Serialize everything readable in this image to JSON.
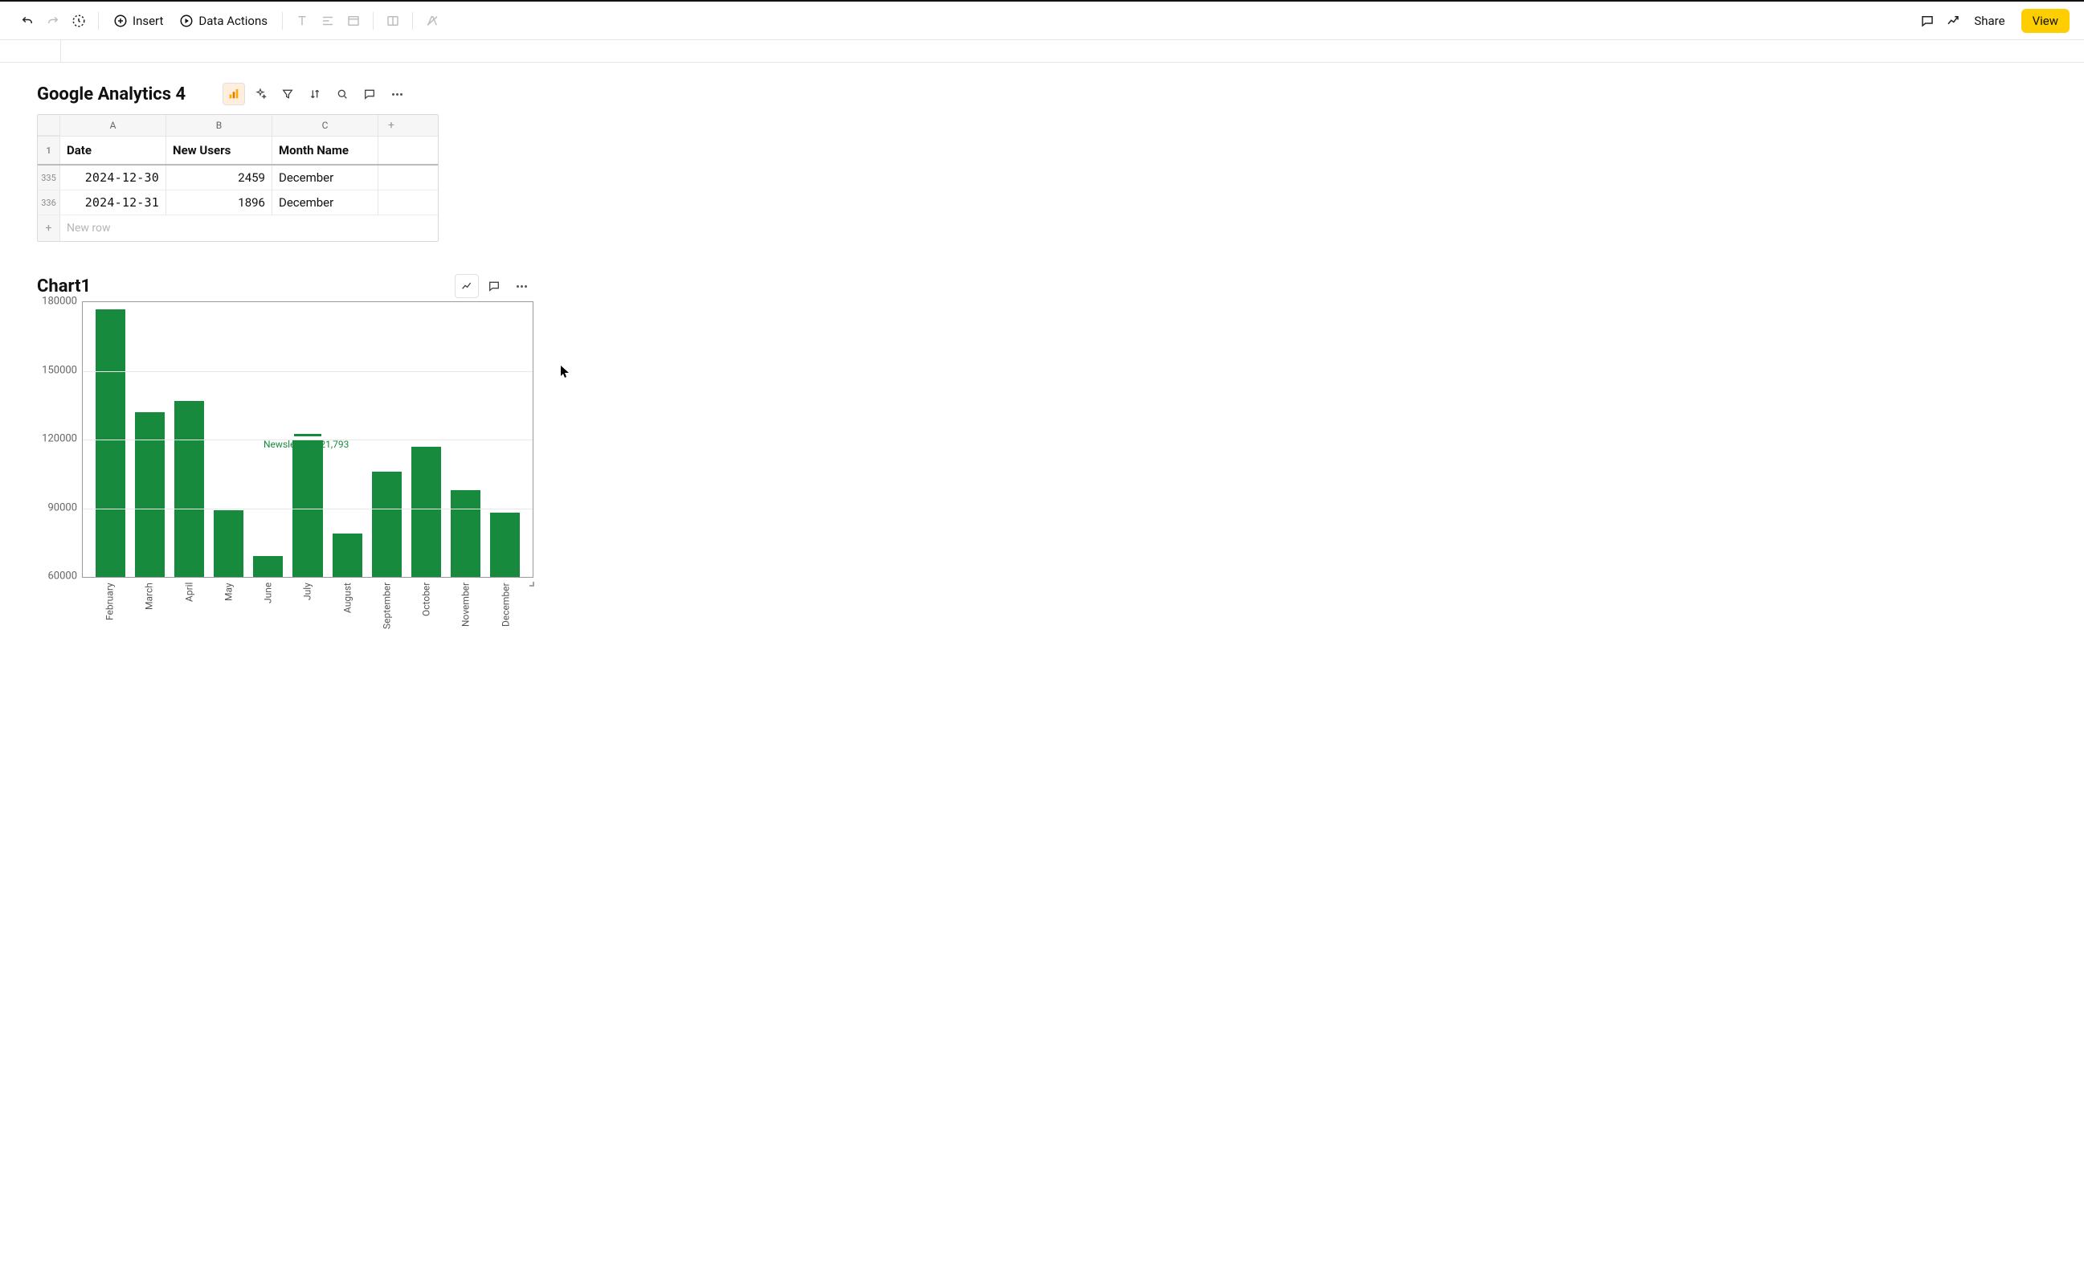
{
  "toolbar": {
    "insert_label": "Insert",
    "data_actions_label": "Data Actions",
    "share_label": "Share",
    "view_label": "View"
  },
  "table": {
    "title": "Google Analytics 4",
    "col_letters": [
      "A",
      "B",
      "C"
    ],
    "headers": {
      "a": "Date",
      "b": "New Users",
      "c": "Month Name"
    },
    "rows": [
      {
        "num": "335",
        "date": "2024-12-30",
        "new_users": "2459",
        "month": "December"
      },
      {
        "num": "336",
        "date": "2024-12-31",
        "new_users": "1896",
        "month": "December"
      }
    ],
    "new_row_placeholder": "New row"
  },
  "chart": {
    "title": "Chart1",
    "goal_label": "Newsletter: 121,793"
  },
  "chart_data": {
    "type": "bar",
    "categories": [
      "February",
      "March",
      "April",
      "May",
      "June",
      "July",
      "August",
      "September",
      "October",
      "November",
      "December"
    ],
    "values": [
      177000,
      132000,
      137000,
      89000,
      69000,
      120000,
      79000,
      106000,
      117000,
      98000,
      88000
    ],
    "ylabel": "",
    "xlabel": "",
    "ylim": [
      60000,
      180000
    ],
    "yticks": [
      60000,
      90000,
      120000,
      150000,
      180000
    ],
    "annotations": [
      {
        "text": "Newsletter: 121,793",
        "y": 121793
      }
    ]
  }
}
